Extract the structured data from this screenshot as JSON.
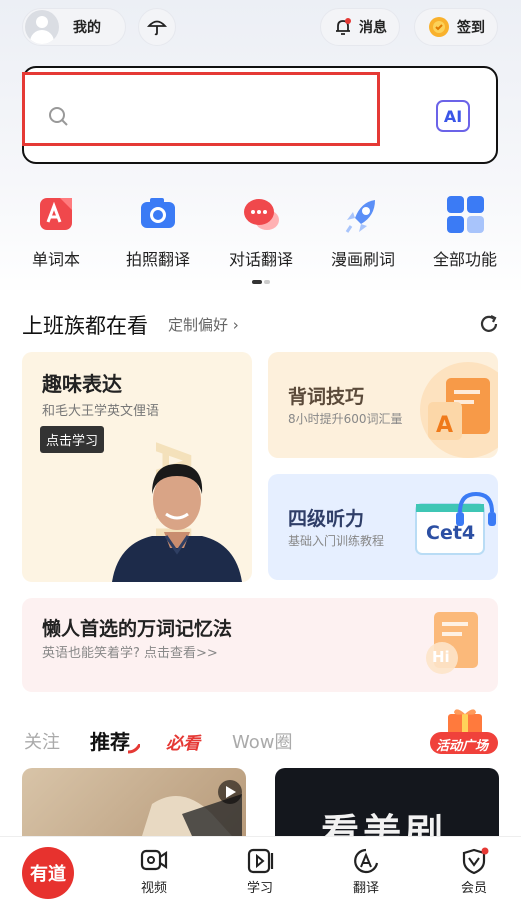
{
  "header": {
    "profile_label": "我的",
    "messages_label": "消息",
    "checkin_label": "签到"
  },
  "search": {
    "placeholder": "",
    "ai_label": "AI"
  },
  "functions": [
    {
      "label": "单词本",
      "icon": "wordbook-icon"
    },
    {
      "label": "拍照翻译",
      "icon": "camera-icon"
    },
    {
      "label": "对话翻译",
      "icon": "chat-icon"
    },
    {
      "label": "漫画刷词",
      "icon": "rocket-icon"
    },
    {
      "label": "全部功能",
      "icon": "grid-icon"
    }
  ],
  "section": {
    "title": "上班族都在看",
    "customize": "定制偏好 ›"
  },
  "cards": {
    "fun": {
      "title": "趣味表达",
      "sub": "和毛大王学英文俚语",
      "button": "点击学习",
      "watermark": "ARLIS"
    },
    "tips": {
      "title": "背词技巧",
      "sub": "8小时提升600词汇量"
    },
    "cet4": {
      "title": "四级听力",
      "sub": "基础入门训练教程",
      "badge": "Cet4"
    },
    "lazy": {
      "title": "懒人首选的万词记忆法",
      "sub": "英语也能笑着学? 点击查看>>",
      "badge": "Hi"
    }
  },
  "tabs": [
    {
      "label": "关注"
    },
    {
      "label": "推荐"
    },
    {
      "label": "必看"
    },
    {
      "label": "Wow圈"
    }
  ],
  "activity_label": "活动广场",
  "feed": {
    "right_title": "看美剧"
  },
  "bottom_nav": {
    "logo": "有道",
    "items": [
      {
        "label": "视频"
      },
      {
        "label": "学习"
      },
      {
        "label": "翻译"
      },
      {
        "label": "会员"
      }
    ]
  }
}
